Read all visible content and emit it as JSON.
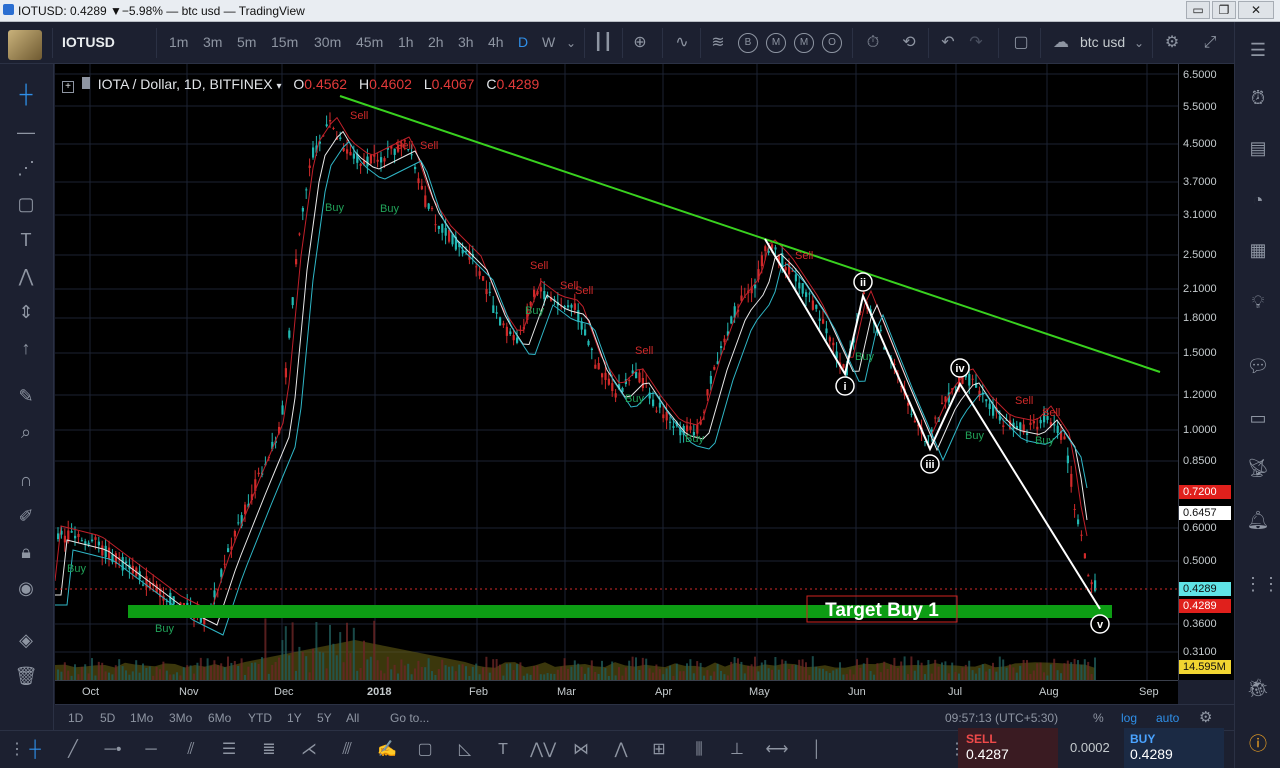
{
  "window": {
    "title": "IOTUSD: 0.4289 ▼−5.98% — btc usd — TradingView",
    "controls": [
      "▭",
      "❐",
      "✕"
    ]
  },
  "toolbar": {
    "symbol": "IOTUSD",
    "timeframes": [
      "1m",
      "3m",
      "5m",
      "15m",
      "30m",
      "45m",
      "1h",
      "2h",
      "3h",
      "4h",
      "D",
      "W"
    ],
    "active_timeframe": "D",
    "chart_name": "btc usd",
    "indicator_badges": [
      "B",
      "M",
      "M",
      "O"
    ]
  },
  "legend": {
    "name": "IOTA / Dollar, 1D, BITFINEX",
    "o_label": "O",
    "o_val": "0.4562",
    "h_label": "H",
    "h_val": "0.4602",
    "l_label": "L",
    "l_val": "0.4067",
    "c_label": "C",
    "c_val": "0.4289"
  },
  "price_axis": {
    "labels": [
      "6.5000",
      "5.5000",
      "4.5000",
      "3.7000",
      "3.1000",
      "2.5000",
      "2.1000",
      "1.8000",
      "1.5000",
      "1.2000",
      "1.0000",
      "0.8500",
      "0.6000",
      "0.5000",
      "0.3600",
      "0.3100"
    ],
    "tag_red1": "0.7200",
    "tag_white": "0.6457",
    "tag_cyan": "0.4289",
    "tag_red2": "0.4289",
    "tag_volume": "14.595M"
  },
  "time_axis": {
    "labels": [
      "Oct",
      "Nov",
      "Dec",
      "2018",
      "Feb",
      "Mar",
      "Apr",
      "May",
      "Jun",
      "Jul",
      "Aug",
      "Sep"
    ]
  },
  "annotations": {
    "target_label": "Target Buy 1",
    "wave_labels": [
      "i",
      "ii",
      "iii",
      "iv",
      "v"
    ],
    "sell_label": "Sell",
    "buy_label": "Buy"
  },
  "range_bar": {
    "ranges": [
      "1D",
      "5D",
      "1Mo",
      "3Mo",
      "6Mo",
      "YTD",
      "1Y",
      "5Y",
      "All"
    ],
    "goto": "Go to...",
    "clock": "09:57:13 (UTC+5:30)",
    "percent": "%",
    "log": "log",
    "auto": "auto"
  },
  "trade": {
    "sell_label": "SELL",
    "sell_price": "0.4287",
    "spread": "0.0002",
    "buy_label": "BUY",
    "buy_price": "0.4289"
  },
  "colors": {
    "trendline": "#39d11f",
    "target_zone": "#0d9d14",
    "wave": "#ffffff",
    "up_candle": "#21b8b2",
    "down_candle": "#d12a2a",
    "accent": "#2f8fe8"
  }
}
